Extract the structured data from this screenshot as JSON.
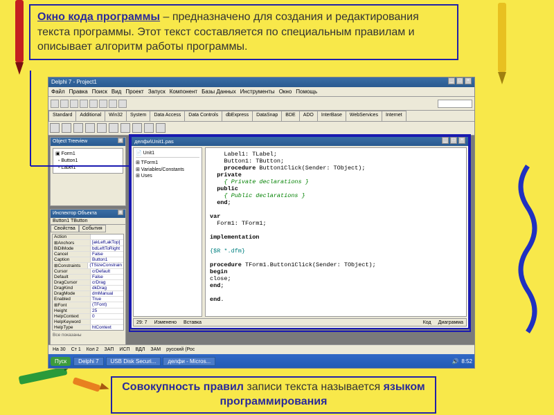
{
  "top_caption": {
    "title": "Окно кода программы",
    "rest": " – предназначено для создания и редактирования текста программы. Этот текст составляется по специальным правилам и описывает алгоритм работы программы."
  },
  "bottom_caption": {
    "pre": "",
    "em1": "Совокупность правил",
    "mid": " записи текста называется ",
    "em2": "языком программирования"
  },
  "ide": {
    "title": "Delphi 7 - Project1",
    "menu": [
      "Файл",
      "Правка",
      "Поиск",
      "Вид",
      "Проект",
      "Запуск",
      "Компонент",
      "Базы Данных",
      "Инструменты",
      "Окно",
      "Помощь"
    ],
    "tabs": [
      "Standard",
      "Additional",
      "Win32",
      "System",
      "Data Access",
      "Data Controls",
      "dbExpress",
      "DataSnap",
      "BDE",
      "ADO",
      "InterBase",
      "WebServices",
      "Internet"
    ],
    "tree_panel": {
      "title": "Object Treeview",
      "items": [
        "Form1",
        "  Button1",
        "  Label1"
      ]
    },
    "inspector": {
      "title": "Инспектор Объекта",
      "object": "Button1    TButton",
      "tabs": [
        "Свойства",
        "События"
      ],
      "props": [
        {
          "k": "Action",
          "v": ""
        },
        {
          "k": "⊞Anchors",
          "v": "[akLeft,akTop]"
        },
        {
          "k": "BiDiMode",
          "v": "bdLeftToRight"
        },
        {
          "k": "Cancel",
          "v": "False"
        },
        {
          "k": "Caption",
          "v": "Button1"
        },
        {
          "k": "⊞Constraints",
          "v": "(TSizeConstrain"
        },
        {
          "k": "Cursor",
          "v": "crDefault"
        },
        {
          "k": "Default",
          "v": "False"
        },
        {
          "k": "DragCursor",
          "v": "crDrag"
        },
        {
          "k": "DragKind",
          "v": "dkDrag"
        },
        {
          "k": "DragMode",
          "v": "dmManual"
        },
        {
          "k": "Enabled",
          "v": "True"
        },
        {
          "k": "⊞Font",
          "v": "(TFont)"
        },
        {
          "k": "Height",
          "v": "25"
        },
        {
          "k": "HelpContext",
          "v": "0"
        },
        {
          "k": "HelpKeyword",
          "v": ""
        },
        {
          "k": "HelpType",
          "v": "htContext"
        }
      ],
      "footer": "Все показаны"
    },
    "code_win": {
      "title": "делфи\\Unit1.pas",
      "left_items": [
        "⊞ TForm1",
        "⊞ Variables/Constants",
        "⊞ Uses"
      ],
      "unit_tab": "Unit1",
      "lines": [
        "    Label1: TLabel;",
        "    Button1: TButton;",
        "    procedure Button1Click(Sender: TObject);",
        "  private",
        "    { Private declarations }",
        "  public",
        "    { Public declarations }",
        "  end;",
        "",
        "var",
        "  Form1: TForm1;",
        "",
        "implementation",
        "",
        "{$R *.dfm}",
        "",
        "procedure TForm1.Button1Click(Sender: TObject);",
        "begin",
        "close;",
        "end;",
        "",
        "end."
      ],
      "status": [
        "29: 7",
        "Изменено",
        "Вставка"
      ],
      "bottom_tabs": [
        "Код",
        "Диаграмма"
      ]
    },
    "statusbar": [
      "На 30",
      "Ст 1",
      "Кол 2",
      "ЗАП",
      "ИСП",
      "ВДЛ",
      "ЗАМ",
      "русский (Рос"
    ],
    "taskbar": {
      "start": "Пуск",
      "items": [
        "Delphi 7",
        "USB Disk Securi...",
        "делфи - Micros..."
      ],
      "time": "8:52"
    }
  }
}
